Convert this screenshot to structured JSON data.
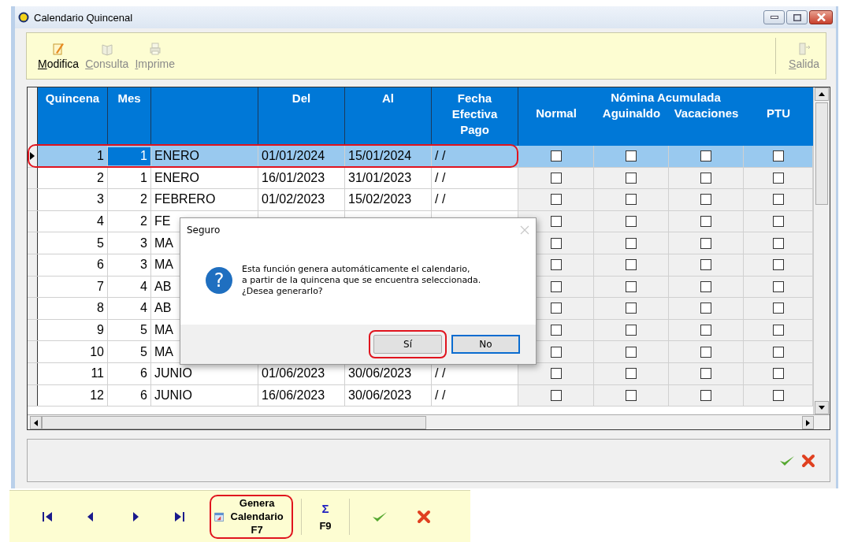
{
  "window": {
    "title": "Calendario Quincenal"
  },
  "toolbar": {
    "items": [
      {
        "label": "Modifica",
        "disabled": false,
        "kind": "edit"
      },
      {
        "label": "Consulta",
        "disabled": true,
        "kind": "view"
      },
      {
        "label": "Imprime",
        "disabled": true,
        "kind": "print"
      }
    ],
    "exit": {
      "label": "Salida",
      "disabled": true
    }
  },
  "table": {
    "columns": [
      "Quincena",
      "Mes",
      "Del",
      "Al",
      "Fecha Efectiva Pago"
    ],
    "group_title": "Nómina Acumulada",
    "group_columns": [
      "Normal",
      "Aguinaldo",
      "Vacaciones",
      "PTU"
    ],
    "rows": [
      {
        "quincena": "1",
        "mes": "1",
        "mes_nombre": "ENERO",
        "del": "01/01/2024",
        "al": "15/01/2024",
        "fecha": "/ /",
        "selected": true,
        "mes_focused": true,
        "circled": true,
        "normal": false,
        "aguinaldo": false,
        "vacaciones": false,
        "ptu": false
      },
      {
        "quincena": "2",
        "mes": "1",
        "mes_nombre": "ENERO",
        "del": "16/01/2023",
        "al": "31/01/2023",
        "fecha": "/ /",
        "selected": false,
        "mes_focused": false,
        "circled": false,
        "normal": false,
        "aguinaldo": false,
        "vacaciones": false,
        "ptu": false
      },
      {
        "quincena": "3",
        "mes": "2",
        "mes_nombre": "FEBRERO",
        "del": "01/02/2023",
        "al": "15/02/2023",
        "fecha": "/ /",
        "selected": false,
        "mes_focused": false,
        "circled": false,
        "normal": false,
        "aguinaldo": false,
        "vacaciones": false,
        "ptu": false
      },
      {
        "quincena": "4",
        "mes": "2",
        "mes_nombre": "FE",
        "selected": false,
        "mes_focused": false,
        "circled": false,
        "normal": false,
        "aguinaldo": false,
        "vacaciones": false,
        "ptu": false
      },
      {
        "quincena": "5",
        "mes": "3",
        "mes_nombre": "MA",
        "selected": false,
        "mes_focused": false,
        "circled": false,
        "normal": false,
        "aguinaldo": false,
        "vacaciones": false,
        "ptu": false
      },
      {
        "quincena": "6",
        "mes": "3",
        "mes_nombre": "MA",
        "selected": false,
        "mes_focused": false,
        "circled": false,
        "normal": false,
        "aguinaldo": false,
        "vacaciones": false,
        "ptu": false
      },
      {
        "quincena": "7",
        "mes": "4",
        "mes_nombre": "AB",
        "selected": false,
        "mes_focused": false,
        "circled": false,
        "normal": false,
        "aguinaldo": false,
        "vacaciones": false,
        "ptu": false
      },
      {
        "quincena": "8",
        "mes": "4",
        "mes_nombre": "AB",
        "selected": false,
        "mes_focused": false,
        "circled": false,
        "normal": false,
        "aguinaldo": false,
        "vacaciones": false,
        "ptu": false
      },
      {
        "quincena": "9",
        "mes": "5",
        "mes_nombre": "MA",
        "selected": false,
        "mes_focused": false,
        "circled": false,
        "normal": false,
        "aguinaldo": false,
        "vacaciones": false,
        "ptu": false
      },
      {
        "quincena": "10",
        "mes": "5",
        "mes_nombre": "MA",
        "selected": false,
        "mes_focused": false,
        "circled": false,
        "normal": false,
        "aguinaldo": false,
        "vacaciones": false,
        "ptu": false
      },
      {
        "quincena": "11",
        "mes": "6",
        "mes_nombre": "JUNIO",
        "del": "01/06/2023",
        "al": "30/06/2023",
        "fecha": "/ /",
        "selected": false,
        "mes_focused": false,
        "circled": false,
        "normal": false,
        "aguinaldo": false,
        "vacaciones": false,
        "ptu": false
      },
      {
        "quincena": "12",
        "mes": "6",
        "mes_nombre": "JUNIO",
        "del": "16/06/2023",
        "al": "30/06/2023",
        "fecha": "/ /",
        "selected": false,
        "mes_focused": false,
        "circled": false,
        "normal": false,
        "aguinaldo": false,
        "vacaciones": false,
        "ptu": false
      }
    ]
  },
  "dialog": {
    "title": "Seguro",
    "icon": "?",
    "message": "Esta función genera automáticamente el calendario,\na partir de la quincena que se encuentra seleccionada.\n¿Desea generarlo?",
    "buttons": [
      {
        "label": "Sí",
        "default": false,
        "circled": true
      },
      {
        "label": "No",
        "default": true,
        "circled": false
      }
    ]
  },
  "navigator": {
    "generate": {
      "label": "Genera Calendario",
      "key": "F7",
      "circled": true
    },
    "sum": {
      "symbol": "Σ",
      "key": "F9"
    }
  }
}
